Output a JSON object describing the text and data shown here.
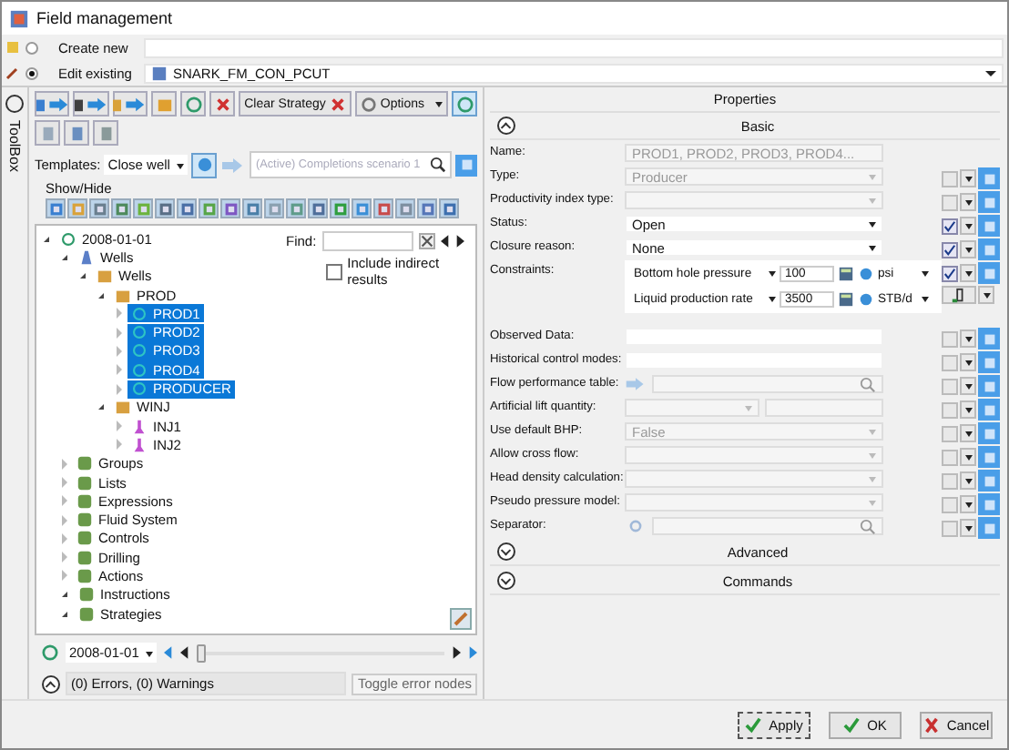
{
  "window": {
    "title": "Field management"
  },
  "mode": [
    {
      "label": "Create new",
      "selected": false
    },
    {
      "label": "Edit existing",
      "selected": true,
      "value": "SNARK_FM_CON_PCUT"
    }
  ],
  "toolbox": {
    "label": "ToolBox"
  },
  "toolbar": {
    "clear_label": "Clear Strategy",
    "options_label": "Options"
  },
  "templates": {
    "label": "Templates:",
    "value": "Close well",
    "search_placeholder": "(Active) Completions scenario 1"
  },
  "show_hide": {
    "label": "Show/Hide"
  },
  "find": {
    "label": "Find:",
    "include_label": "Include indirect results",
    "include_checked": false
  },
  "tree": [
    {
      "label": "2008-01-01",
      "kind": "date",
      "expanded": true,
      "selected": false,
      "children": [
        {
          "label": "Wells",
          "kind": "wells",
          "expanded": true,
          "selected": false,
          "children": [
            {
              "label": "Wells",
              "kind": "folder",
              "expanded": true,
              "selected": false,
              "children": [
                {
                  "label": "PROD",
                  "kind": "folder",
                  "expanded": true,
                  "selected": false,
                  "children": [
                    {
                      "label": "PROD1",
                      "kind": "producer",
                      "expanded": false,
                      "selected": true
                    },
                    {
                      "label": "PROD2",
                      "kind": "producer",
                      "expanded": false,
                      "selected": true
                    },
                    {
                      "label": "PROD3",
                      "kind": "producer",
                      "expanded": false,
                      "selected": true
                    },
                    {
                      "label": "PROD4",
                      "kind": "producer",
                      "expanded": false,
                      "selected": true
                    },
                    {
                      "label": "PRODUCER",
                      "kind": "producer",
                      "expanded": false,
                      "selected": true
                    }
                  ]
                },
                {
                  "label": "WINJ",
                  "kind": "folder",
                  "expanded": true,
                  "selected": false,
                  "children": [
                    {
                      "label": "INJ1",
                      "kind": "injector",
                      "expanded": false,
                      "selected": false
                    },
                    {
                      "label": "INJ2",
                      "kind": "injector",
                      "expanded": false,
                      "selected": false
                    }
                  ]
                }
              ]
            }
          ]
        },
        {
          "label": "Groups",
          "kind": "category",
          "expanded": false,
          "selected": false
        },
        {
          "label": "Lists",
          "kind": "category",
          "expanded": false,
          "selected": false
        },
        {
          "label": "Expressions",
          "kind": "category",
          "expanded": false,
          "selected": false
        },
        {
          "label": "Fluid System",
          "kind": "category",
          "expanded": false,
          "selected": false
        },
        {
          "label": "Controls",
          "kind": "category",
          "expanded": false,
          "selected": false
        },
        {
          "label": "Drilling",
          "kind": "category",
          "expanded": false,
          "selected": false
        },
        {
          "label": "Actions",
          "kind": "category",
          "expanded": false,
          "selected": false
        },
        {
          "label": "Instructions",
          "kind": "category",
          "expanded": true,
          "selected": false
        },
        {
          "label": "Strategies",
          "kind": "category",
          "expanded": true,
          "selected": false
        }
      ]
    }
  ],
  "timeline": {
    "date": "2008-01-01",
    "level": 0
  },
  "errors": {
    "summary": "(0) Errors, (0) Warnings",
    "toggle_label": "Toggle error nodes"
  },
  "properties": {
    "title": "Properties",
    "basic_label": "Basic",
    "rows": [
      {
        "label": "Name:",
        "kind": "text",
        "value": "PROD1, PROD2, PROD3, PROD4...",
        "disabled": true
      },
      {
        "label": "Type:",
        "kind": "select",
        "value": "Producer",
        "disabled": true,
        "checked": false
      },
      {
        "label": "Productivity index type:",
        "kind": "select",
        "disabled": true,
        "checked": false
      },
      {
        "label": "Status:",
        "kind": "select",
        "value": "Open",
        "disabled": false,
        "checked": true
      },
      {
        "label": "Closure reason:",
        "kind": "select",
        "value": "None",
        "disabled": false,
        "checked": true
      },
      {
        "label": "Constraints:",
        "kind": "constraints",
        "disabled": false,
        "checked": true
      },
      {
        "label": "Observed Data:",
        "kind": "text",
        "disabled": false,
        "checked": false
      },
      {
        "label": "Historical control modes:",
        "kind": "text",
        "disabled": false,
        "checked": false
      },
      {
        "label": "Flow performance table:",
        "kind": "lookup",
        "disabled": true,
        "checked": false
      },
      {
        "label": "Artificial lift quantity:",
        "kind": "double",
        "disabled": true,
        "checked": false
      },
      {
        "label": "Use default BHP:",
        "kind": "select",
        "value": "False",
        "disabled": true,
        "checked": false
      },
      {
        "label": "Allow cross flow:",
        "kind": "select",
        "disabled": true,
        "checked": false
      },
      {
        "label": "Head density calculation:",
        "kind": "select",
        "disabled": true,
        "checked": false
      },
      {
        "label": "Pseudo pressure model:",
        "kind": "select",
        "disabled": true,
        "checked": false
      },
      {
        "label": "Separator:",
        "kind": "picker",
        "disabled": true,
        "checked": false
      }
    ],
    "constraints": [
      {
        "quantity": "Bottom hole pressure",
        "value": "100",
        "unit": "psi"
      },
      {
        "quantity": "Liquid production rate",
        "value": "3500",
        "unit": "STB/d"
      }
    ],
    "sections": [
      {
        "label": "Advanced",
        "expanded": false
      },
      {
        "label": "Commands",
        "expanded": false
      }
    ]
  },
  "buttons": [
    {
      "label": "Apply",
      "kind": "apply"
    },
    {
      "label": "OK",
      "kind": "ok"
    },
    {
      "label": "Cancel",
      "kind": "cancel"
    }
  ]
}
